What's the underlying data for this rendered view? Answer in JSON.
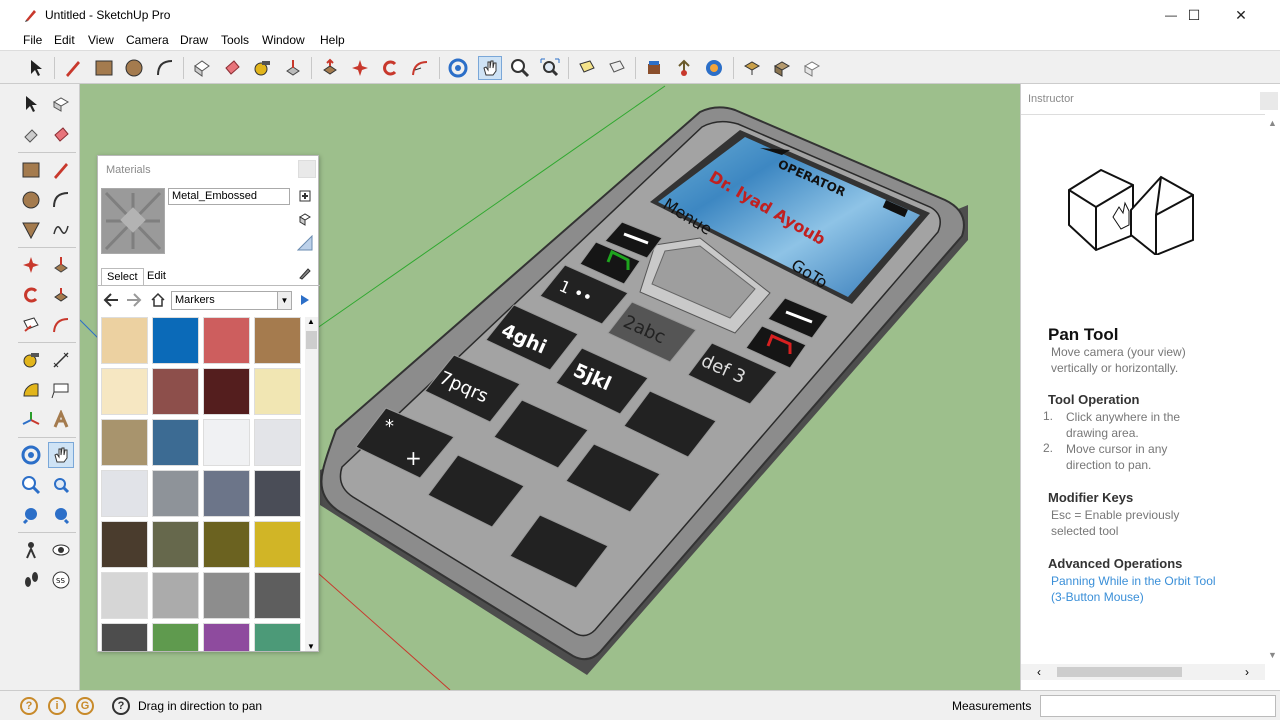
{
  "window": {
    "title": "Untitled - SketchUp Pro",
    "minimize_glyph": "—",
    "maximize_glyph": "☐",
    "close_glyph": "✕"
  },
  "menu": {
    "items": [
      "File",
      "Edit",
      "View",
      "Camera",
      "Draw",
      "Tools",
      "Window",
      "Help"
    ]
  },
  "toolbar": {
    "tools": [
      "select-icon",
      "pencil-icon",
      "rectangle-icon",
      "circle-icon",
      "arc-icon",
      "eraser-box-icon",
      "paint-bucket-icon",
      "tape-measure-icon",
      "push-pull-icon",
      "move-icon",
      "rotate-icon",
      "offset-icon",
      "orbit-icon",
      "pan-icon",
      "zoom-icon",
      "zoom-extents-icon",
      "text-icon",
      "section-icon",
      "warehouse-icon",
      "share-icon",
      "extension-icon",
      "export-icon",
      "import-icon",
      "layout-icon"
    ],
    "active_tool": "pan-icon"
  },
  "materials": {
    "title": "Materials",
    "name_value": "Metal_Embossed",
    "tab_select": "Select",
    "tab_edit": "Edit",
    "collection": "Markers",
    "swatches": [
      "#ecd1a1",
      "#0b6ab8",
      "#cd5e5e",
      "#a57b4e",
      "#f6e7c2",
      "#8d4f4b",
      "#541e1e",
      "#f1e6b3",
      "#a8946d",
      "#3c6b93",
      "#f0f1f3",
      "#e3e4e8",
      "#e1e3e8",
      "#8e9399",
      "#6c7589",
      "#4a4d57",
      "#4a3c2d",
      "#66684c",
      "#6b6220",
      "#d1b526",
      "#d6d6d6",
      "#ababab",
      "#8d8d8d",
      "#5e5e5e",
      "#4d4d4d",
      "#5f9a4e",
      "#8e4b9e",
      "#4c9a78"
    ]
  },
  "phone_model": {
    "operator_text": "OPERATOR",
    "owner_text": "Dr. Iyad Ayoub",
    "left_soft": "Menue",
    "right_soft": "GoTo",
    "keys": [
      "1 ••",
      "2abc",
      "def 3",
      "4ghi",
      "5jkl",
      "7pqrs",
      "*\n+"
    ]
  },
  "instructor": {
    "title": "Instructor",
    "tool_name": "Pan Tool",
    "tool_desc": "Move camera (your view) vertically or horizontally.",
    "op_heading": "Tool Operation",
    "op_steps": [
      "Click anywhere in the drawing area.",
      "Move cursor in any direction to pan."
    ],
    "mod_heading": "Modifier Keys",
    "mod_text": "Esc = Enable previously selected tool",
    "adv_heading": "Advanced Operations",
    "adv_link": "Panning While in the Orbit Tool (3-Button Mouse)",
    "link_color": "#3a8fd8"
  },
  "status": {
    "hint": "Drag in direction to pan",
    "measurements_label": "Measurements",
    "measurements_value": ""
  }
}
